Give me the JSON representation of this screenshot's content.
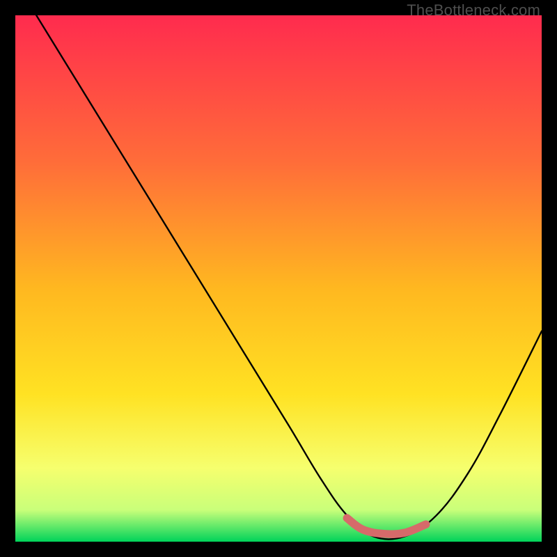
{
  "watermark": "TheBottleneck.com",
  "colors": {
    "gradient_top": "#ff2b4e",
    "gradient_mid1": "#ff8f2a",
    "gradient_mid2": "#ffe223",
    "gradient_low": "#f6ff6e",
    "gradient_bottom": "#00d35a",
    "curve": "#000000",
    "highlight": "#d66a6a",
    "frame": "#000000"
  },
  "chart_data": {
    "type": "line",
    "title": "",
    "xlabel": "",
    "ylabel": "",
    "xlim": [
      0,
      100
    ],
    "ylim": [
      0,
      100
    ],
    "grid": false,
    "series": [
      {
        "name": "bottleneck-curve",
        "x": [
          4,
          12,
          20,
          28,
          36,
          44,
          52,
          58,
          63,
          68,
          74,
          80,
          86,
          92,
          100
        ],
        "y": [
          100,
          87,
          74,
          61,
          48,
          35,
          22,
          12,
          5,
          1,
          1,
          5,
          13,
          24,
          40
        ]
      }
    ],
    "highlight_segment": {
      "name": "optimal-range",
      "x": [
        63,
        66,
        70,
        74,
        78
      ],
      "y": [
        4.5,
        2.3,
        1.5,
        1.7,
        3.3
      ]
    }
  }
}
